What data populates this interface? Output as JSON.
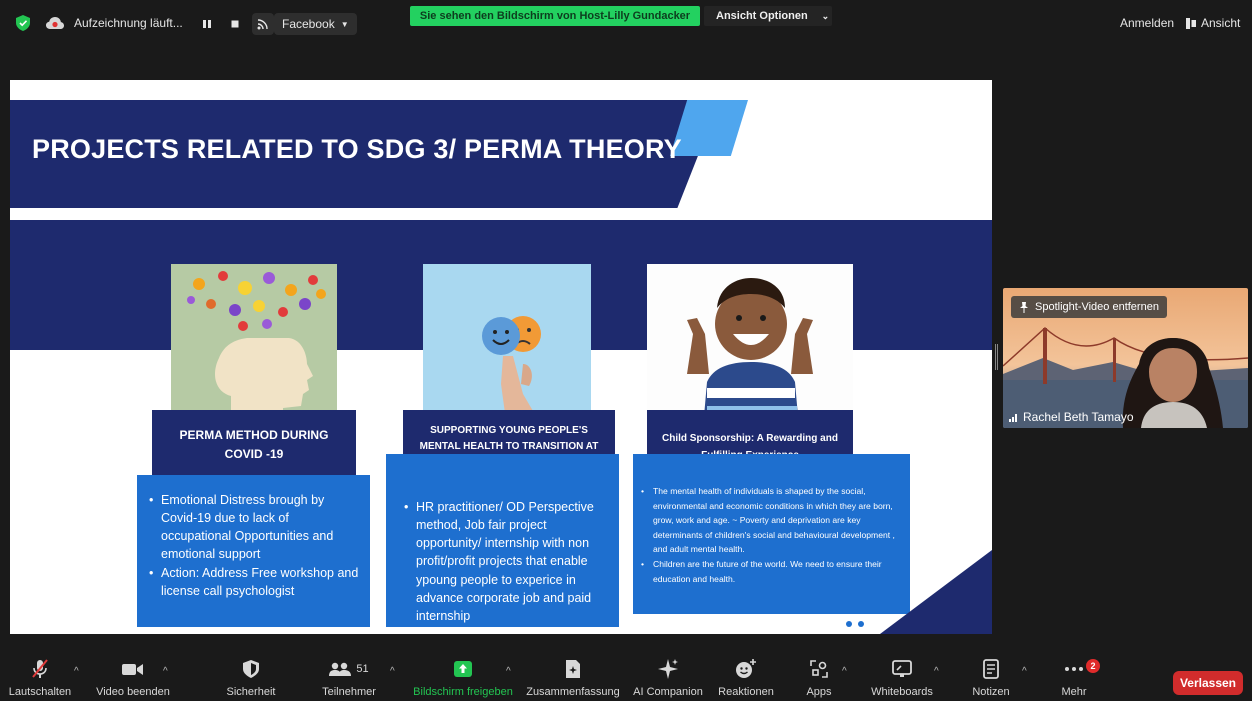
{
  "topbar": {
    "recording_label": "Aufzeichnung läuft...",
    "stream_target": "Facebook",
    "share_banner": "Sie sehen den Bildschirm von Host-Lilly Gundacker",
    "view_options": "Ansicht Optionen",
    "signin": "Anmelden",
    "view": "Ansicht"
  },
  "slide": {
    "title": "PROJECTS RELATED TO SDG 3/ PERMA THEORY",
    "cards": [
      {
        "label": "PERMA METHOD DURING COVID -19",
        "bullets": [
          "Emotional Distress brough by Covid-19 due to lack of occupational Opportunities and emotional support",
          "Action: Address Free workshop and license call psychologist"
        ]
      },
      {
        "label": "SUPPORTING YOUNG PEOPLE'S MENTAL HEALTH TO TRANSITION AT WORK",
        "bullets": [
          "HR practitioner/ OD Perspective method, Job fair project opportunity/ internship with non profit/profit projects that enable ypoung people to experice in advance corporate job and paid internship"
        ]
      },
      {
        "label": "Child Sponsorship: A Rewarding and Fulfilling Experience",
        "bullets": [
          "The mental health of individuals is shaped by the social, environmental and economic conditions in which they are born, grow, work and age. ~ Poverty and deprivation are key determinants of children's social and behavioural development , and adult mental health.",
          "Children are the future of the world. We need to ensure their education and health."
        ]
      }
    ]
  },
  "video": {
    "spotlight_label": "Spotlight-Video entfernen",
    "participant_name": "Rachel Beth Tamayo"
  },
  "toolbar": {
    "mute": "Lautschalten",
    "video": "Video beenden",
    "security": "Sicherheit",
    "participants": "Teilnehmer",
    "participants_count": "51",
    "share": "Bildschirm freigeben",
    "summary": "Zusammenfassung",
    "ai": "AI Companion",
    "reactions": "Reaktionen",
    "apps": "Apps",
    "whiteboards": "Whiteboards",
    "notes": "Notizen",
    "more": "Mehr",
    "more_badge": "2",
    "leave": "Verlassen"
  },
  "colors": {
    "slide_navy": "#1e2a6e",
    "slide_blue": "#1e6fcf",
    "accent_blue": "#4fa6ee",
    "share_green": "#23d160",
    "leave_red": "#d12c2c"
  }
}
